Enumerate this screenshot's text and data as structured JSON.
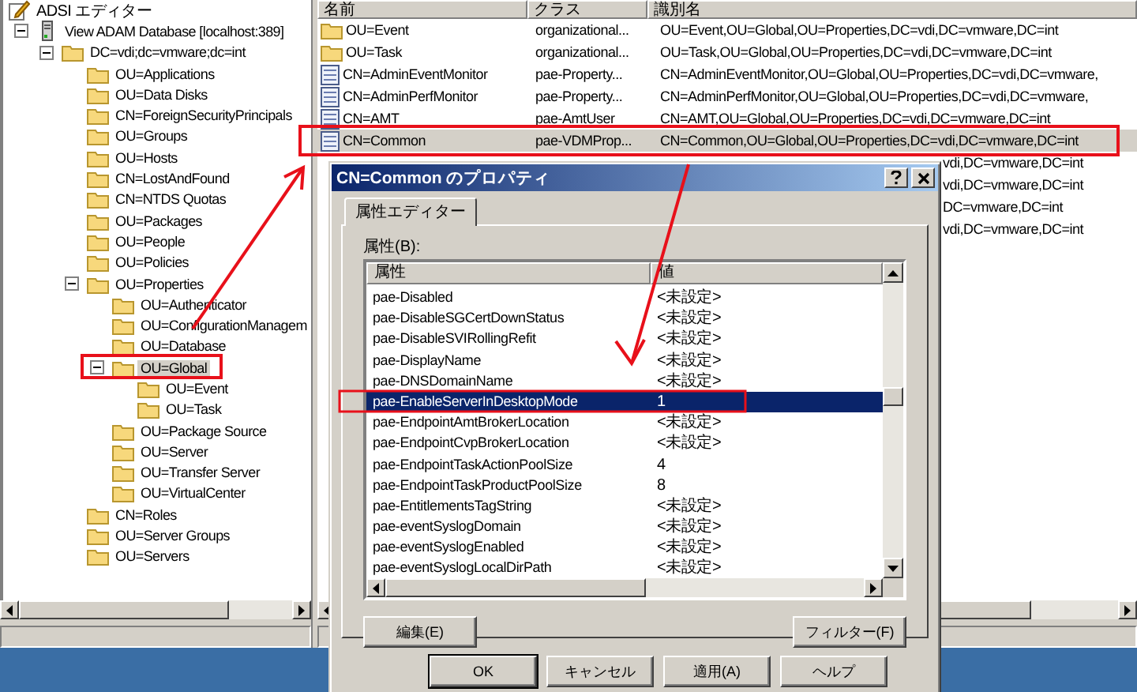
{
  "tree": [
    {
      "label": "ADSI エディター",
      "kind": "editor",
      "selected": false,
      "children": [
        {
          "label": "View ADAM Database [localhost:389]",
          "kind": "server",
          "selected": false,
          "expanded": true,
          "children": [
            {
              "label": "DC=vdi;dc=vmware;dc=int",
              "kind": "folder",
              "selected": false,
              "expanded": true,
              "children": [
                {
                  "label": "OU=Applications",
                  "kind": "folder",
                  "selected": false
                },
                {
                  "label": "OU=Data Disks",
                  "kind": "folder",
                  "selected": false
                },
                {
                  "label": "CN=ForeignSecurityPrincipals",
                  "kind": "folder",
                  "selected": false
                },
                {
                  "label": "OU=Groups",
                  "kind": "folder",
                  "selected": false
                },
                {
                  "label": "OU=Hosts",
                  "kind": "folder",
                  "selected": false
                },
                {
                  "label": "CN=LostAndFound",
                  "kind": "folder",
                  "selected": false
                },
                {
                  "label": "CN=NTDS Quotas",
                  "kind": "folder",
                  "selected": false
                },
                {
                  "label": "OU=Packages",
                  "kind": "folder",
                  "selected": false
                },
                {
                  "label": "OU=People",
                  "kind": "folder",
                  "selected": false
                },
                {
                  "label": "OU=Policies",
                  "kind": "folder",
                  "selected": false
                },
                {
                  "label": "OU=Properties",
                  "kind": "folder",
                  "selected": false,
                  "expanded": true,
                  "children": [
                    {
                      "label": "OU=Authenticator",
                      "kind": "folder",
                      "selected": false
                    },
                    {
                      "label": "OU=ConfigurationManagem",
                      "kind": "folder",
                      "selected": false
                    },
                    {
                      "label": "OU=Database",
                      "kind": "folder",
                      "selected": false
                    },
                    {
                      "label": "OU=Global",
                      "kind": "folder",
                      "selected": true,
                      "expanded": true,
                      "children": [
                        {
                          "label": "OU=Event",
                          "kind": "folder",
                          "selected": false
                        },
                        {
                          "label": "OU=Task",
                          "kind": "folder",
                          "selected": false
                        }
                      ]
                    },
                    {
                      "label": "OU=Package Source",
                      "kind": "folder",
                      "selected": false
                    },
                    {
                      "label": "OU=Server",
                      "kind": "folder",
                      "selected": false
                    },
                    {
                      "label": "OU=Transfer Server",
                      "kind": "folder",
                      "selected": false
                    },
                    {
                      "label": "OU=VirtualCenter",
                      "kind": "folder",
                      "selected": false
                    }
                  ]
                },
                {
                  "label": "CN=Roles",
                  "kind": "folder",
                  "selected": false
                },
                {
                  "label": "OU=Server Groups",
                  "kind": "folder",
                  "selected": false
                },
                {
                  "label": "OU=Servers",
                  "kind": "folder",
                  "selected": false
                }
              ]
            }
          ]
        }
      ]
    }
  ],
  "list": {
    "columns": [
      "名前",
      "クラス",
      "識別名"
    ],
    "rows": [
      {
        "kind": "folder",
        "name": "OU=Event",
        "class": "organizational...",
        "dn": "OU=Event,OU=Global,OU=Properties,DC=vdi,DC=vmware,DC=int",
        "selected": false
      },
      {
        "kind": "folder",
        "name": "OU=Task",
        "class": "organizational...",
        "dn": "OU=Task,OU=Global,OU=Properties,DC=vdi,DC=vmware,DC=int",
        "selected": false
      },
      {
        "kind": "object",
        "name": "CN=AdminEventMonitor",
        "class": "pae-Property...",
        "dn": "CN=AdminEventMonitor,OU=Global,OU=Properties,DC=vdi,DC=vmware,",
        "selected": false
      },
      {
        "kind": "object",
        "name": "CN=AdminPerfMonitor",
        "class": "pae-Property...",
        "dn": "CN=AdminPerfMonitor,OU=Global,OU=Properties,DC=vdi,DC=vmware,",
        "selected": false
      },
      {
        "kind": "object",
        "name": "CN=AMT",
        "class": "pae-AmtUser",
        "dn": "CN=AMT,OU=Global,OU=Properties,DC=vdi,DC=vmware,DC=int",
        "selected": false
      },
      {
        "kind": "object",
        "name": "CN=Common",
        "class": "pae-VDMProp...",
        "dn": "CN=Common,OU=Global,OU=Properties,DC=vdi,DC=vmware,DC=int",
        "selected": true
      },
      {
        "kind": "covered",
        "dn": "vdi,DC=vmware,DC=int",
        "selected": false
      },
      {
        "kind": "covered",
        "dn": "vdi,DC=vmware,DC=int",
        "selected": false
      },
      {
        "kind": "covered",
        "dn": "DC=vmware,DC=int",
        "selected": false
      },
      {
        "kind": "covered",
        "dn": "vdi,DC=vmware,DC=int",
        "selected": false
      }
    ]
  },
  "dialog": {
    "title": "CN=Common のプロパティ",
    "tabs": [
      {
        "label": "属性エディター",
        "selected": true
      }
    ],
    "attributes_label": "属性(B):",
    "columns": [
      "属性",
      "値"
    ],
    "rows": [
      {
        "name": "pae-Disabled",
        "value": "<未設定>",
        "selected": false
      },
      {
        "name": "pae-DisableSGCertDownStatus",
        "value": "<未設定>",
        "selected": false
      },
      {
        "name": "pae-DisableSVIRollingRefit",
        "value": "<未設定>",
        "selected": false
      },
      {
        "name": "pae-DisplayName",
        "value": "<未設定>",
        "selected": false
      },
      {
        "name": "pae-DNSDomainName",
        "value": "<未設定>",
        "selected": false
      },
      {
        "name": "pae-EnableServerInDesktopMode",
        "value": "1",
        "selected": true
      },
      {
        "name": "pae-EndpointAmtBrokerLocation",
        "value": "<未設定>",
        "selected": false
      },
      {
        "name": "pae-EndpointCvpBrokerLocation",
        "value": "<未設定>",
        "selected": false
      },
      {
        "name": "pae-EndpointTaskActionPoolSize",
        "value": "4",
        "selected": false
      },
      {
        "name": "pae-EndpointTaskProductPoolSize",
        "value": "8",
        "selected": false
      },
      {
        "name": "pae-EntitlementsTagString",
        "value": "<未設定>",
        "selected": false
      },
      {
        "name": "pae-eventSyslogDomain",
        "value": "<未設定>",
        "selected": false
      },
      {
        "name": "pae-eventSyslogEnabled",
        "value": "<未設定>",
        "selected": false
      },
      {
        "name": "pae-eventSyslogLocalDirPath",
        "value": "<未設定>",
        "selected": false
      }
    ],
    "edit_button": "編集(E)",
    "filter_button": "フィルター(F)",
    "buttons": [
      "OK",
      "キャンセル",
      "適用(A)",
      "ヘルプ"
    ]
  }
}
